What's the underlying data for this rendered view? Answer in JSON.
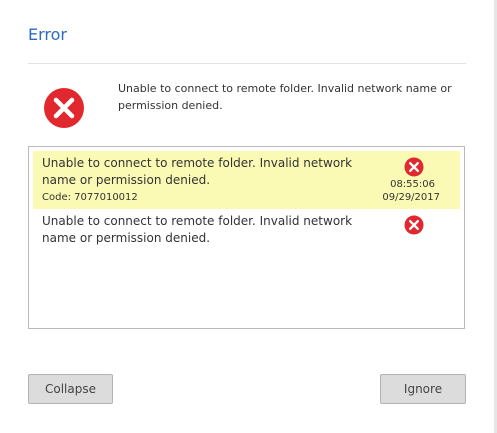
{
  "dialog": {
    "title": "Error",
    "summary": "Unable to connect to remote folder. Invalid network name or permission denied.",
    "summary_icon": "error-x-icon",
    "accent_color": "#2d6bc2",
    "error_color": "#e0282e",
    "highlight_color": "#fafab4"
  },
  "errors": [
    {
      "message": "Unable to connect to remote folder. Invalid network name or permission denied.",
      "code": "Code: 7077010012",
      "time": "08:55:06",
      "date": "09/29/2017",
      "icon": "error-x-icon",
      "selected": true
    },
    {
      "message": "Unable to connect to remote folder. Invalid network name or permission denied.",
      "icon": "error-x-icon",
      "selected": false
    }
  ],
  "buttons": {
    "collapse_label": "Collapse",
    "ignore_label": "Ignore"
  }
}
